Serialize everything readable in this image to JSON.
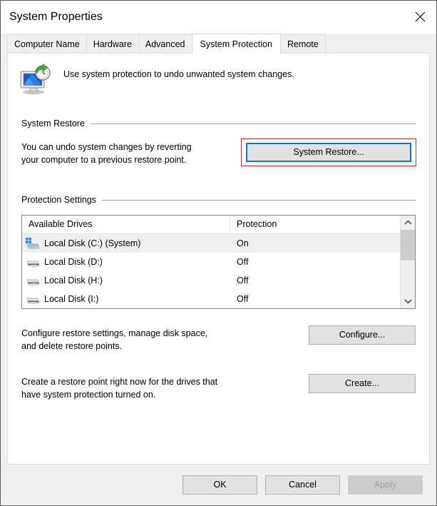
{
  "window": {
    "title": "System Properties",
    "close_icon": "close-icon"
  },
  "tabs": [
    {
      "label": "Computer Name",
      "active": false
    },
    {
      "label": "Hardware",
      "active": false
    },
    {
      "label": "Advanced",
      "active": false
    },
    {
      "label": "System Protection",
      "active": true
    },
    {
      "label": "Remote",
      "active": false
    }
  ],
  "page": {
    "header_icon": "system-protection-icon",
    "header_text": "Use system protection to undo unwanted system changes."
  },
  "system_restore": {
    "group_title": "System Restore",
    "description_line1": "You can undo system changes by reverting",
    "description_line2": "your computer to a previous restore point.",
    "button_label": "System Restore...",
    "button_focused": true,
    "annotation_color": "#e02a2a",
    "focus_color": "#0078d7"
  },
  "protection_settings": {
    "group_title": "Protection Settings",
    "columns": [
      "Available Drives",
      "Protection"
    ],
    "drives": [
      {
        "name": "Local Disk (C:) (System)",
        "protection": "On",
        "selected": true,
        "icon": "system-drive-icon"
      },
      {
        "name": "Local Disk (D:)",
        "protection": "Off",
        "selected": false,
        "icon": "drive-icon"
      },
      {
        "name": "Local Disk (H:)",
        "protection": "Off",
        "selected": false,
        "icon": "drive-icon"
      },
      {
        "name": "Local Disk (I:)",
        "protection": "Off",
        "selected": false,
        "icon": "drive-icon"
      }
    ],
    "scroll_up_icon": "chevron-up-icon",
    "scroll_down_icon": "chevron-down-icon",
    "configure": {
      "description_line1": "Configure restore settings, manage disk space,",
      "description_line2": "and delete restore points.",
      "button_label": "Configure..."
    },
    "create": {
      "description_line1": "Create a restore point right now for the drives that",
      "description_line2": "have system protection turned on.",
      "button_label": "Create..."
    }
  },
  "dialog_buttons": {
    "ok": "OK",
    "cancel": "Cancel",
    "apply": "Apply",
    "apply_disabled": true
  }
}
